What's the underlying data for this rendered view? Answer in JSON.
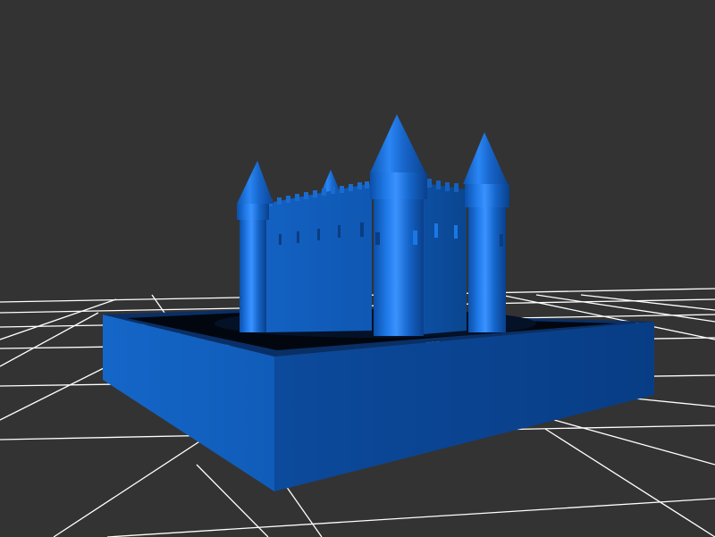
{
  "scene": {
    "background_color": "#333333",
    "grid_color": "#ffffff",
    "model_color": "#1a6fd6",
    "model_shadow_color": "#0a3f8a",
    "model_highlight_color": "#3d95ff",
    "model": "castle",
    "base": "square-moat-base",
    "tower_count": 4,
    "grid_visible": true
  }
}
